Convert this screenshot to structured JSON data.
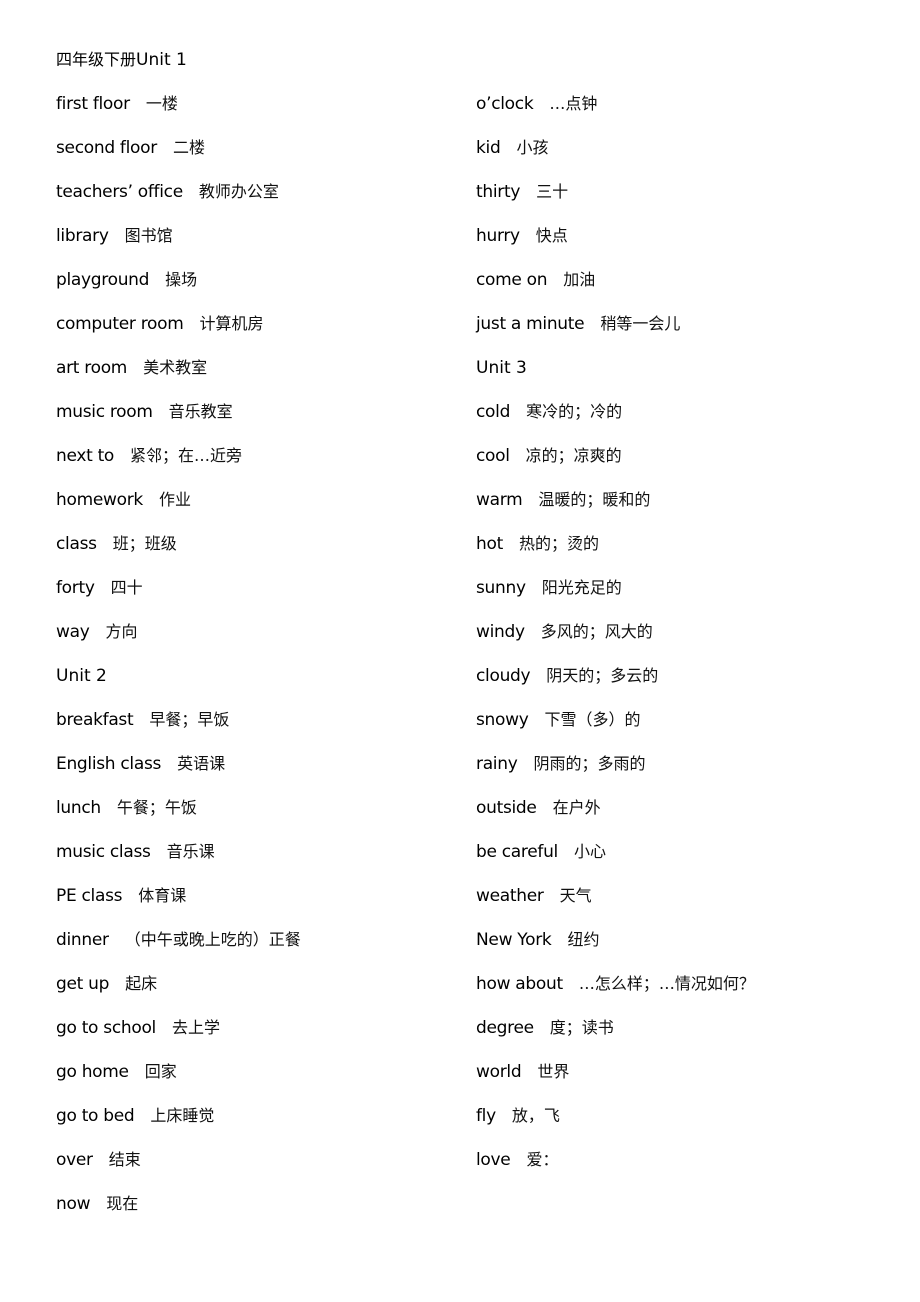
{
  "document": {
    "title_cn": "四年级下册",
    "title_en": "Unit 1",
    "left_column": [
      {
        "en": "first floor",
        "cn": "一楼"
      },
      {
        "en": "second floor",
        "cn": "二楼"
      },
      {
        "en": "teachers’ office",
        "cn": "教师办公室"
      },
      {
        "en": "library",
        "cn": "图书馆"
      },
      {
        "en": "playground",
        "cn": "操场"
      },
      {
        "en": "computer room",
        "cn": "计算机房"
      },
      {
        "en": "art room",
        "cn": "美术教室"
      },
      {
        "en": "music room",
        "cn": "音乐教室"
      },
      {
        "en": "next to",
        "cn": "紧邻；在…近旁"
      },
      {
        "en": "homework",
        "cn": "作业"
      },
      {
        "en": "class",
        "cn": " 班；班级"
      },
      {
        "en": "forty",
        "cn": "四十"
      },
      {
        "en": "way",
        "cn": "方向"
      },
      {
        "en": "Unit 2",
        "cn": "",
        "heading": true
      },
      {
        "en": "breakfast",
        "cn": "早餐；早饭"
      },
      {
        "en": "English class",
        "cn": "英语课"
      },
      {
        "en": "lunch",
        "cn": "午餐；午饭"
      },
      {
        "en": "music class",
        "cn": "音乐课"
      },
      {
        "en": "PE class",
        "cn": "体育课"
      },
      {
        "en": "dinner",
        "cn": " （中午或晚上吃的）正餐"
      },
      {
        "en": "get up",
        "cn": " 起床"
      },
      {
        "en": "go to school",
        "cn": "去上学"
      },
      {
        "en": "go home",
        "cn": " 回家"
      },
      {
        "en": "go to bed",
        "cn": "上床睡觉"
      },
      {
        "en": "over",
        "cn": "结束"
      },
      {
        "en": "now",
        "cn": "现在"
      }
    ],
    "right_column": [
      {
        "en": "o’clock",
        "cn": "…点钟"
      },
      {
        "en": "kid",
        "cn": "小孩"
      },
      {
        "en": "thirty",
        "cn": "三十"
      },
      {
        "en": "hurry",
        "cn": " 快点"
      },
      {
        "en": "come on",
        "cn": "加油"
      },
      {
        "en": "just a minute",
        "cn": "稍等一会儿"
      },
      {
        "en": "Unit 3",
        "cn": "",
        "heading": true
      },
      {
        "en": "cold",
        "cn": "寒冷的；冷的"
      },
      {
        "en": "cool",
        "cn": "凉的；凉爽的"
      },
      {
        "en": "warm",
        "cn": "温暖的；暖和的"
      },
      {
        "en": "hot",
        "cn": "热的；烫的"
      },
      {
        "en": "sunny",
        "cn": "阳光充足的"
      },
      {
        "en": "windy",
        "cn": "多风的；风大的"
      },
      {
        "en": "cloudy",
        "cn": "阴天的；多云的"
      },
      {
        "en": "snowy",
        "cn": "下雪（多）的"
      },
      {
        "en": "rainy",
        "cn": "阴雨的；多雨的"
      },
      {
        "en": "outside",
        "cn": "在户外"
      },
      {
        "en": "be careful",
        "cn": "小心"
      },
      {
        "en": "weather",
        "cn": "天气"
      },
      {
        "en": "New York",
        "cn": "纽约"
      },
      {
        "en": "how about",
        "cn": "…怎么样；…情况如何？"
      },
      {
        "en": "degree",
        "cn": " 度；读书"
      },
      {
        "en": "world",
        "cn": "世界"
      },
      {
        "en": "fly",
        "cn": "放，飞"
      },
      {
        "en": "love",
        "cn": "爱："
      }
    ]
  }
}
